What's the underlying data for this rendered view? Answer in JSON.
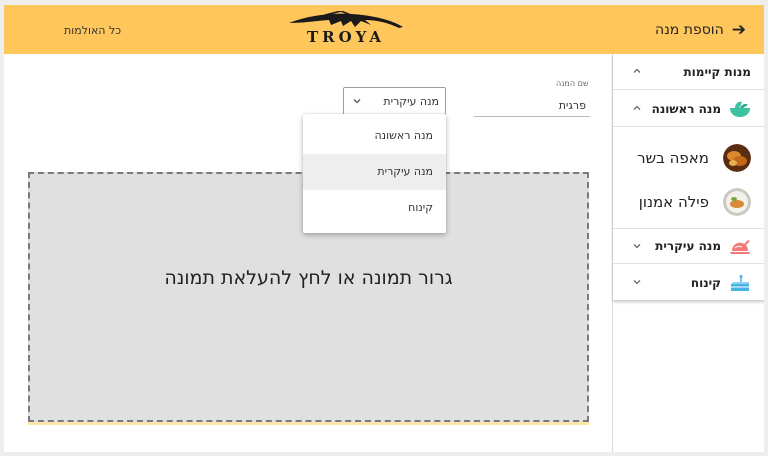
{
  "header": {
    "title": "הוספת מנה",
    "back_icon": "arrow-right-icon",
    "all_dishes_link": "כל האולמות",
    "logo_text": "TROYA",
    "color": "#ffc65c"
  },
  "sidebar": {
    "existing_dishes_title": "מנות קיימות",
    "categories": [
      {
        "title": "מנה ראשונה",
        "icon": "salad-bowl-icon",
        "icon_color": "#3cc2a0",
        "expanded": true,
        "items": [
          {
            "name": "מאפה בשר",
            "thumb": "meat-pastry-thumb"
          },
          {
            "name": "פילה אמנון",
            "thumb": "fish-fillet-thumb"
          }
        ]
      },
      {
        "title": "מנה עיקרית",
        "icon": "roast-chicken-icon",
        "icon_color": "#f47a7a",
        "expanded": false
      },
      {
        "title": "קינוח",
        "icon": "cake-slice-icon",
        "icon_color": "#46b3e6",
        "expanded": false
      }
    ]
  },
  "form": {
    "dish_name_label": "שם המנה",
    "dish_name_value": "פרגית",
    "category_select_value": "מנה עיקרית",
    "category_options": [
      {
        "label": "מנה ראשונה",
        "selected": false
      },
      {
        "label": "מנה עיקרית",
        "selected": true
      },
      {
        "label": "קינוח",
        "selected": false
      }
    ],
    "dropzone_text": "גרור תמונה או לחץ להעלאת תמונה"
  }
}
